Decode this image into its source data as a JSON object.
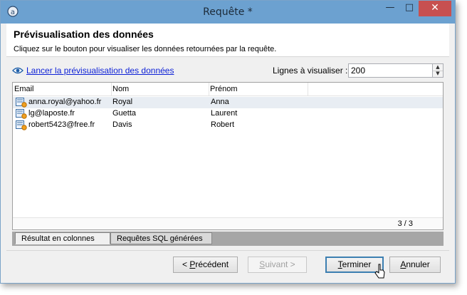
{
  "window": {
    "title": "Requête *"
  },
  "header": {
    "title": "Prévisualisation des données",
    "subtitle": "Cliquez sur le bouton pour visualiser les données retournées par la requête."
  },
  "preview": {
    "link_label": "Lancer la prévisualisation des données",
    "lines_label": "Lignes à visualiser :",
    "lines_value": "200"
  },
  "grid": {
    "columns": [
      "Email",
      "Nom",
      "Prénom"
    ],
    "rows": [
      {
        "email": "anna.royal@yahoo.fr",
        "nom": "Royal",
        "prenom": "Anna"
      },
      {
        "email": "lg@laposte.fr",
        "nom": "Guetta",
        "prenom": "Laurent"
      },
      {
        "email": "robert5423@free.fr",
        "nom": "Davis",
        "prenom": "Robert"
      }
    ],
    "count": "3 / 3"
  },
  "tabs": [
    "Résultat en colonnes",
    "Requêtes SQL générées"
  ],
  "buttons": {
    "previous": {
      "prefix": "< ",
      "mnemonic": "P",
      "rest": "récédent"
    },
    "next": {
      "mnemonic": "S",
      "rest": "uivant >"
    },
    "finish": {
      "mnemonic": "T",
      "rest": "erminer"
    },
    "cancel": {
      "mnemonic": "A",
      "rest": "nnuler"
    }
  },
  "icons": [
    "app-icon",
    "minimize-icon",
    "maximize-icon",
    "close-icon",
    "eye-icon",
    "record-icon",
    "spin-up-icon",
    "spin-down-icon",
    "mouse-cursor-icon"
  ],
  "colors": {
    "titlebar": "#6ca1d0",
    "close": "#c75050",
    "link": "#0b1fd6"
  }
}
